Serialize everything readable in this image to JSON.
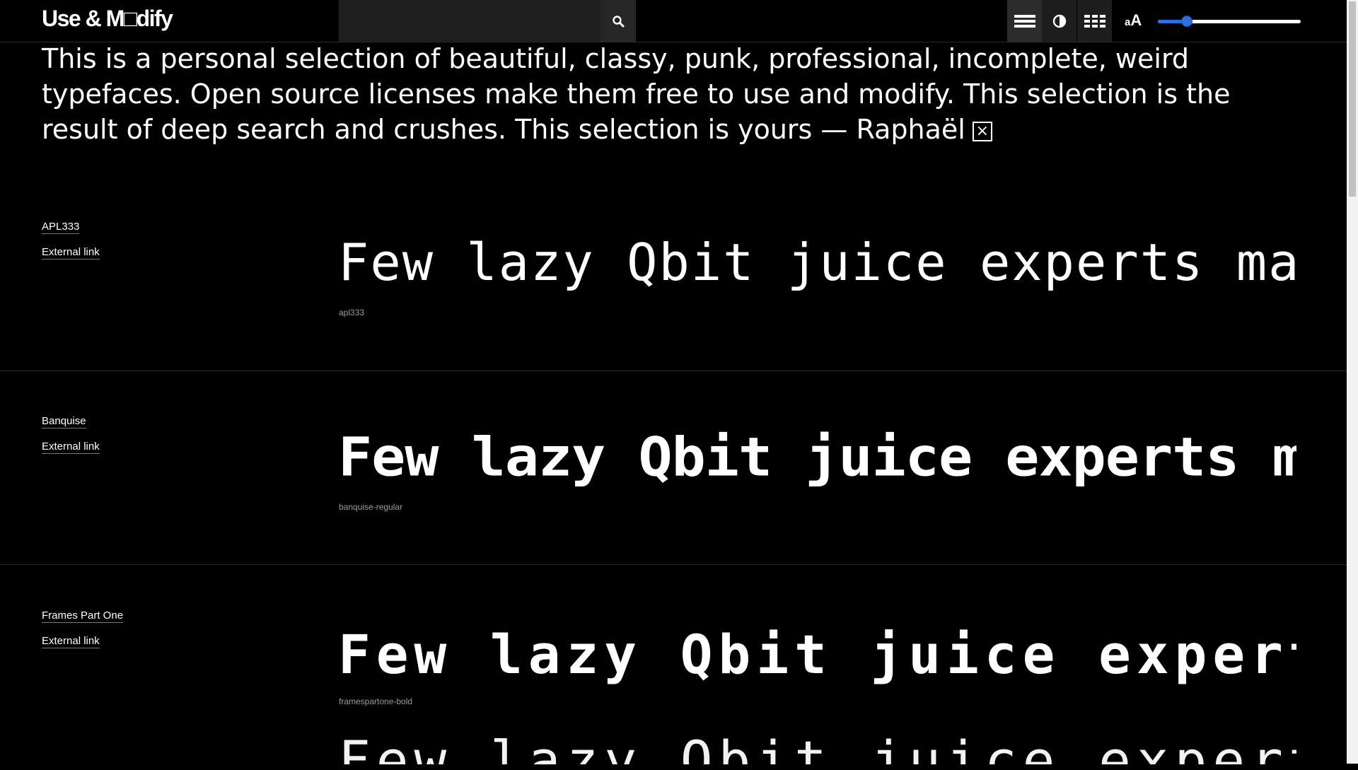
{
  "header": {
    "logo": "Use & M□dify",
    "search": {
      "value": "",
      "placeholder": ""
    },
    "tools": [
      {
        "icon": "list-view-icon",
        "active": true
      },
      {
        "icon": "contrast-icon",
        "active": false
      },
      {
        "icon": "grid-view-icon",
        "active": false
      }
    ],
    "size_label_small": "a",
    "size_label_big": "A",
    "size_slider": {
      "value_fraction": 0.18
    }
  },
  "intro": {
    "text": "This is a personal selection of beautiful, classy, punk, professional, incomplete, weird typefaces. Open source licenses make them free to use and modify. This selection is the result of deep search and crushes. This selection is yours — Raphaël",
    "close_label": "×"
  },
  "sample_text": "Few lazy Qbit juice experts make dog happy",
  "fonts": [
    {
      "name": "APL333",
      "link": "External link",
      "file": "apl333"
    },
    {
      "name": "Banquise",
      "link": "External link",
      "file": "banquise-regular"
    },
    {
      "name": "Frames Part One",
      "link": "External link",
      "file": "framespartone-bold"
    }
  ],
  "colors": {
    "background": "#000000",
    "text": "#ffffff",
    "accent": "#2f6fe0"
  }
}
